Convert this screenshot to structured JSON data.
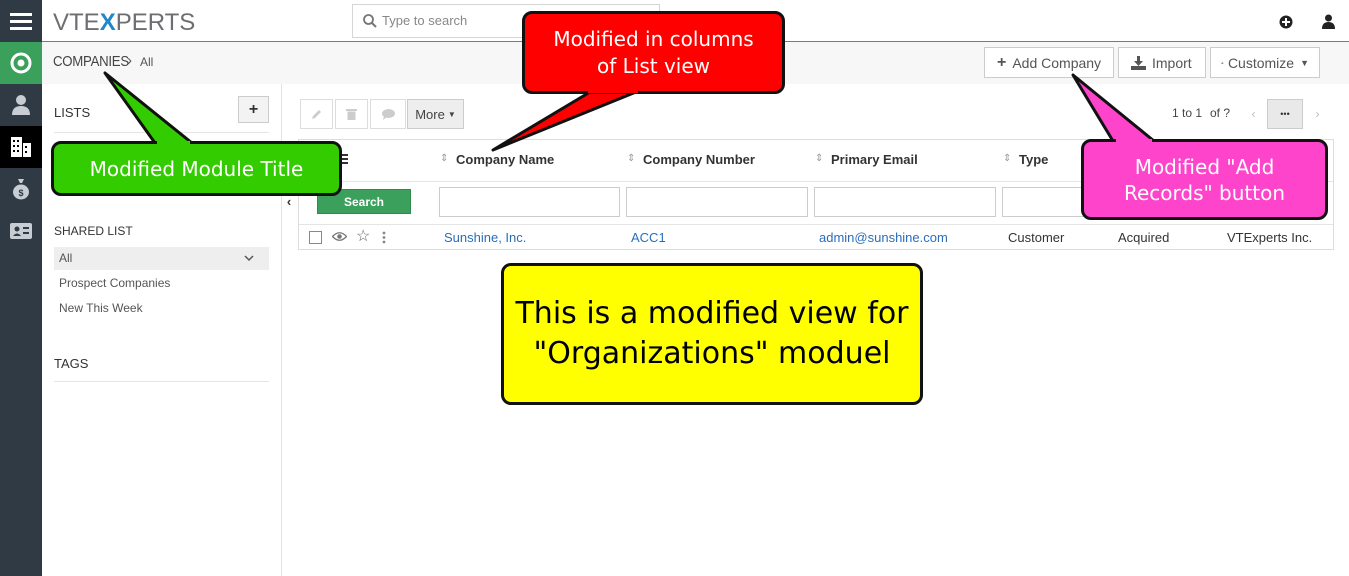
{
  "app": {
    "logo_pre": "VTE",
    "logo_x": "X",
    "logo_post": "PERTS"
  },
  "search": {
    "placeholder": "Type to search"
  },
  "breadcrumb": {
    "module": "COMPANIES",
    "separator": "›",
    "view": "All"
  },
  "toolbar": {
    "add_label": "Add Company",
    "import_label": "Import",
    "customize_label": "Customize",
    "more_label": "More"
  },
  "pagination": {
    "range": "1 to 1",
    "of": "of ?",
    "more": "•••"
  },
  "lists": {
    "heading": "LISTS",
    "shared_heading": "SHARED LIST",
    "items": [
      "All",
      "Prospect Companies",
      "New This Week"
    ],
    "tags_heading": "TAGS"
  },
  "table": {
    "columns": [
      "Company Name",
      "Company Number",
      "Primary Email",
      "Type"
    ],
    "search_label": "Search",
    "rows": [
      {
        "name": "Sunshine, Inc.",
        "number": "ACC1",
        "email": "admin@sunshine.com",
        "type": "Customer",
        "status": "Acquired",
        "assigned": "VTExperts Inc."
      }
    ]
  },
  "callouts": {
    "columns_line1": "Modified in columns",
    "columns_line2": "of List view",
    "title": "Modified Module Title",
    "add_line1": "Modified \"Add",
    "add_line2": "Records\" button",
    "main_line1": "This is a modified view for",
    "main_line2": "\"Organizations\" moduel"
  },
  "colors": {
    "rail": "#2f3a45",
    "accent_green": "#3aa05b",
    "link": "#2a6ebb",
    "callout_red": "#ff0000",
    "callout_green": "#33cc00",
    "callout_pink": "#ff44cc",
    "callout_yellow": "#ffff00"
  }
}
